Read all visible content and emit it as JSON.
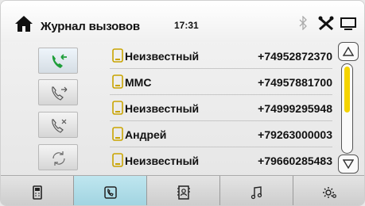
{
  "header": {
    "title": "Журнал вызовов",
    "time": "17:31",
    "icons": [
      "home-icon",
      "bluetooth-icon",
      "tools-icon",
      "screen-icon"
    ]
  },
  "controls": [
    {
      "name": "incoming-calls-button",
      "icon": "incoming-call-icon",
      "active": true
    },
    {
      "name": "outgoing-calls-button",
      "icon": "outgoing-call-icon",
      "active": false
    },
    {
      "name": "missed-calls-button",
      "icon": "missed-call-icon",
      "active": false
    },
    {
      "name": "refresh-button",
      "icon": "refresh-icon",
      "active": false
    }
  ],
  "calls": [
    {
      "name": "Неизвестный",
      "number": "+74952872370"
    },
    {
      "name": "ММС",
      "number": "+74957881700"
    },
    {
      "name": "Неизвестный",
      "number": "+74999295948"
    },
    {
      "name": "Андрей",
      "number": "+79263000003"
    },
    {
      "name": "Неизвестный",
      "number": "+79660285483"
    }
  ],
  "scroll": {
    "position_fraction": 0.0,
    "visible_fraction": 0.55
  },
  "tabs": [
    {
      "name": "tab-phone",
      "icon": "mobile-phone-icon",
      "active": false
    },
    {
      "name": "tab-call-log",
      "icon": "call-log-icon",
      "active": true
    },
    {
      "name": "tab-contacts",
      "icon": "contacts-icon",
      "active": false
    },
    {
      "name": "tab-music",
      "icon": "music-icon",
      "active": false
    },
    {
      "name": "tab-settings",
      "icon": "settings-icon",
      "active": false
    }
  ],
  "colors": {
    "accent_green": "#1e9e3a",
    "tab_active": "#aadbe6",
    "scroll_thumb": "#f5d400",
    "phone_icon": "#c9a400"
  }
}
